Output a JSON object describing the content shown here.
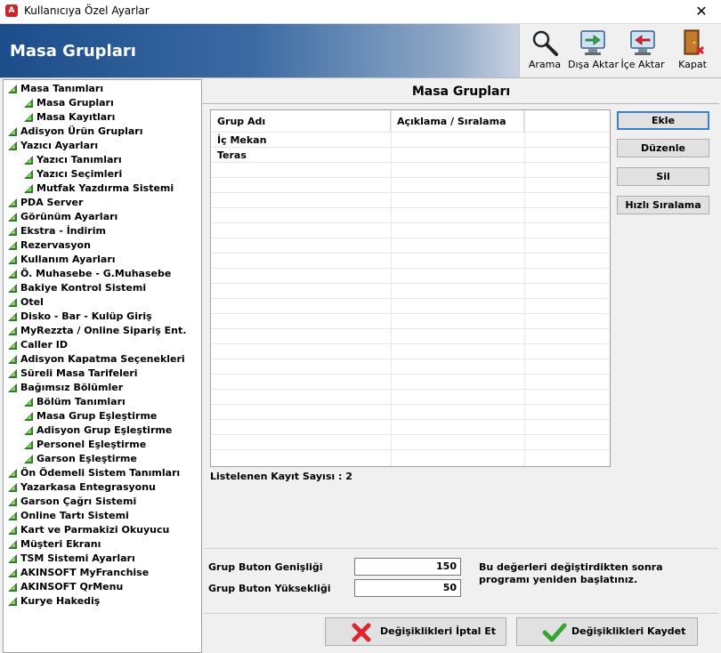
{
  "window": {
    "title": "Kullanıcıya Özel Ayarlar",
    "close": "✕"
  },
  "header": {
    "title": "Masa Grupları"
  },
  "toolbar": [
    {
      "label": "Arama",
      "icon": "magnifier-icon"
    },
    {
      "label": "Dışa Aktar",
      "icon": "export-icon"
    },
    {
      "label": "İçe Aktar",
      "icon": "import-icon"
    },
    {
      "label": "Kapat",
      "icon": "exit-door-icon"
    }
  ],
  "tree": [
    {
      "label": "Masa Tanımları",
      "level": 0
    },
    {
      "label": "Masa Grupları",
      "level": 1
    },
    {
      "label": "Masa Kayıtları",
      "level": 1
    },
    {
      "label": "Adisyon Ürün Grupları",
      "level": 0
    },
    {
      "label": "Yazıcı Ayarları",
      "level": 0
    },
    {
      "label": "Yazıcı Tanımları",
      "level": 1
    },
    {
      "label": "Yazıcı Seçimleri",
      "level": 1
    },
    {
      "label": "Mutfak Yazdırma Sistemi",
      "level": 1
    },
    {
      "label": "PDA Server",
      "level": 0
    },
    {
      "label": "Görünüm Ayarları",
      "level": 0
    },
    {
      "label": "Ekstra - İndirim",
      "level": 0
    },
    {
      "label": "Rezervasyon",
      "level": 0
    },
    {
      "label": "Kullanım Ayarları",
      "level": 0
    },
    {
      "label": "Ö. Muhasebe - G.Muhasebe",
      "level": 0
    },
    {
      "label": "Bakiye Kontrol Sistemi",
      "level": 0
    },
    {
      "label": "Otel",
      "level": 0
    },
    {
      "label": "Disko - Bar - Kulüp Giriş",
      "level": 0
    },
    {
      "label": "MyRezzta / Online Sipariş Ent.",
      "level": 0
    },
    {
      "label": "Caller ID",
      "level": 0
    },
    {
      "label": "Adisyon Kapatma Seçenekleri",
      "level": 0
    },
    {
      "label": "Süreli Masa Tarifeleri",
      "level": 0
    },
    {
      "label": "Bağımsız Bölümler",
      "level": 0
    },
    {
      "label": "Bölüm Tanımları",
      "level": 1
    },
    {
      "label": "Masa Grup Eşleştirme",
      "level": 1
    },
    {
      "label": "Adisyon Grup Eşleştirme",
      "level": 1
    },
    {
      "label": "Personel Eşleştirme",
      "level": 1
    },
    {
      "label": "Garson Eşleştirme",
      "level": 1
    },
    {
      "label": "Ön Ödemeli Sistem Tanımları",
      "level": 0
    },
    {
      "label": "Yazarkasa Entegrasyonu",
      "level": 0
    },
    {
      "label": "Garson Çağrı Sistemi",
      "level": 0
    },
    {
      "label": "Online Tartı Sistemi",
      "level": 0
    },
    {
      "label": "Kart ve Parmakizi Okuyucu",
      "level": 0
    },
    {
      "label": "Müşteri Ekranı",
      "level": 0
    },
    {
      "label": "TSM Sistemi Ayarları",
      "level": 0
    },
    {
      "label": "AKINSOFT MyFranchise",
      "level": 0
    },
    {
      "label": "AKINSOFT QrMenu",
      "level": 0
    },
    {
      "label": "Kurye Hakediş",
      "level": 0
    }
  ],
  "panel": {
    "title": "Masa Grupları"
  },
  "table": {
    "columns": [
      "Grup Adı",
      "Açıklama / Sıralama",
      ""
    ],
    "rows": [
      [
        "İç Mekan",
        "",
        ""
      ],
      [
        "Teras",
        "",
        ""
      ]
    ]
  },
  "side_buttons": [
    "Ekle",
    "Düzenle",
    "Sil",
    "Hızlı Sıralama"
  ],
  "record_count": "Listelenen Kayıt Sayısı : 2",
  "settings": {
    "width_label": "Grup Buton Genişliği",
    "width_value": "150",
    "height_label": "Grup Buton Yüksekliği",
    "height_value": "50",
    "note": "Bu değerleri değiştirdikten sonra programı yeniden başlatınız."
  },
  "actions": {
    "cancel": "Değişiklikleri İptal Et",
    "save": "Değişiklikleri Kaydet"
  },
  "colors": {
    "tree_icon": "#2e7d1e",
    "header_start": "#1c4d8b",
    "primary_border": "#3c7fd1"
  }
}
